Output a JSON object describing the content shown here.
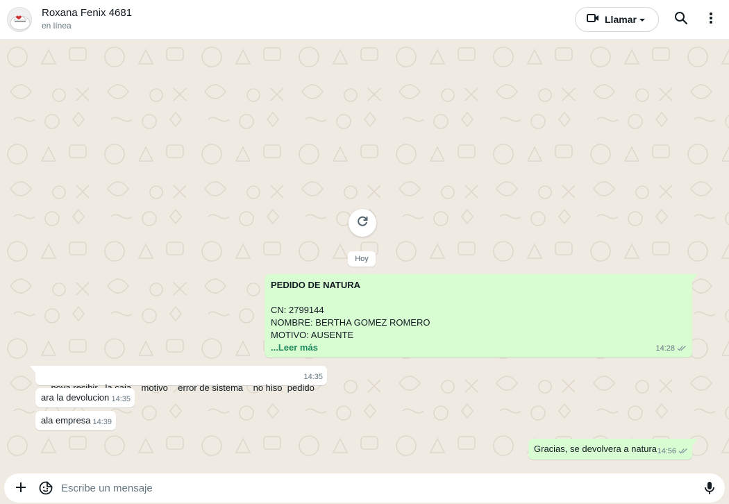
{
  "header": {
    "contact_name": "Roxana Fenix 4681",
    "status": "en línea",
    "call_label": "Llamar",
    "icons": [
      "video-camera-icon",
      "chevron-down-icon",
      "search-icon",
      "more-vertical-icon"
    ]
  },
  "chat": {
    "date_chip": "Hoy",
    "messages": [
      {
        "direction": "out",
        "title": "PEDIDO DE NATURA",
        "lines": [
          "CN:  2799144",
          "NOMBRE:  BERTHA GOMEZ ROMERO",
          "MOTIVO: AUSENTE"
        ],
        "read_more": "...Leer más",
        "time": "14:28",
        "status": "read"
      },
      {
        "direction": "in",
        "text": "nova recibir   la caja    motivo    error de sistema    no hiso  pedido",
        "time": "14:35"
      },
      {
        "direction": "in",
        "text": "ara la devolucion",
        "time": "14:35"
      },
      {
        "direction": "in",
        "text": "ala empresa",
        "time": "14:39"
      },
      {
        "direction": "out",
        "text": "Gracias, se devolvera a natura",
        "time": "14:56",
        "status": "read"
      }
    ]
  },
  "composer": {
    "placeholder": "Escribe un mensaje",
    "value": "",
    "icons": [
      "plus-icon",
      "sticker-icon",
      "microphone-icon"
    ]
  },
  "colors": {
    "outgoing_bubble": "#d9fdd3",
    "incoming_bubble": "#ffffff",
    "chat_background": "#efeae2",
    "read_more": "#1f8a5b"
  }
}
